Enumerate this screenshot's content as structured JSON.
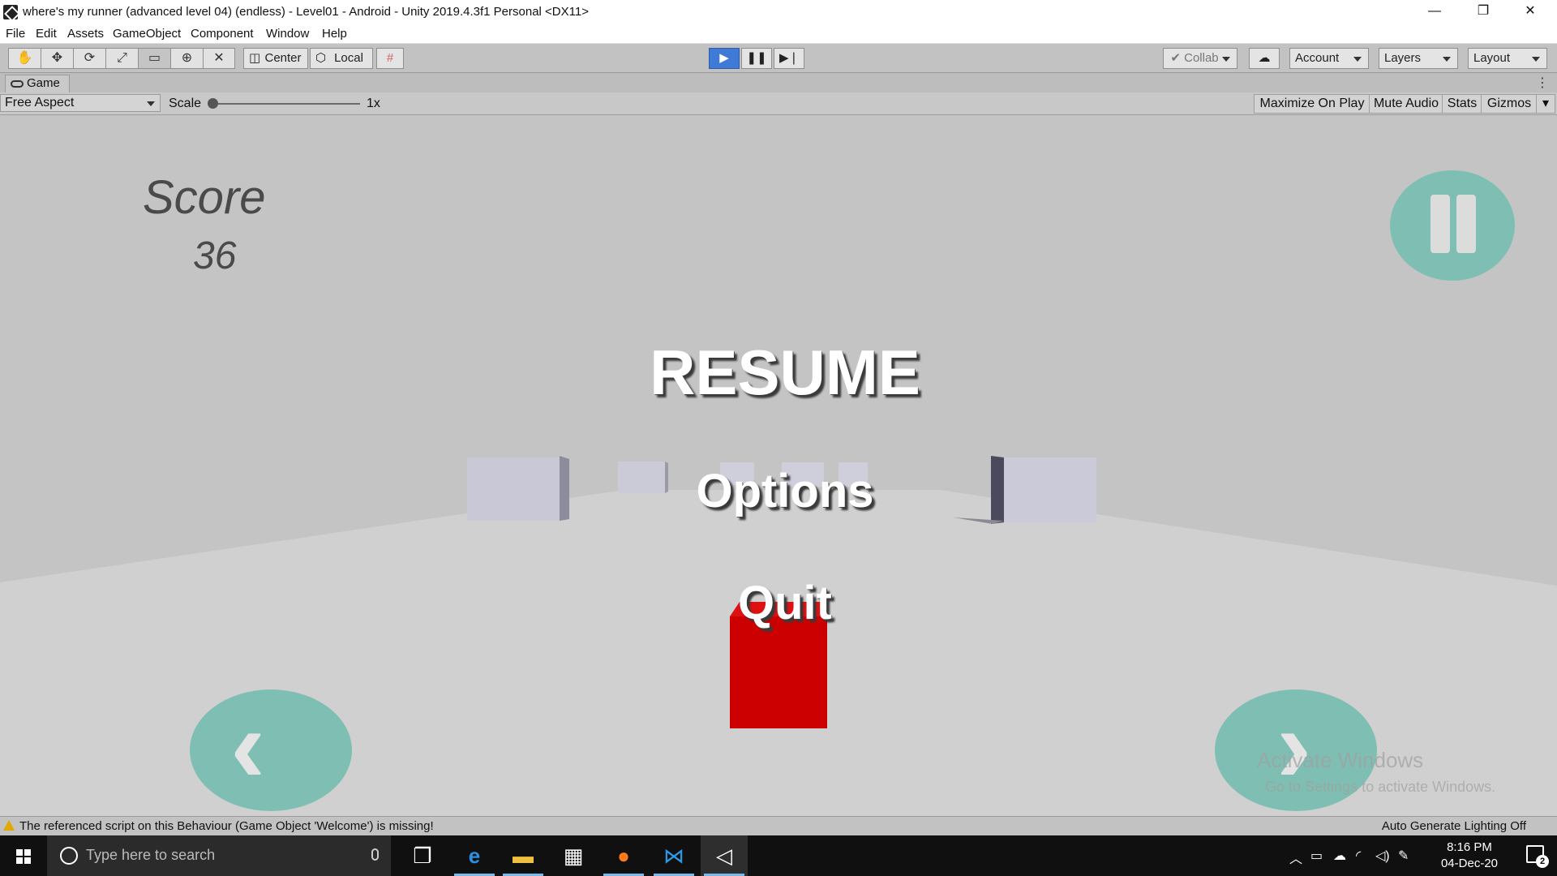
{
  "window": {
    "title": "where's my runner (advanced level 04) (endless) - Level01 - Android - Unity 2019.4.3f1 Personal <DX11>",
    "minimize": "—",
    "restore": "❐",
    "close": "✕"
  },
  "menu": [
    "File",
    "Edit",
    "Assets",
    "GameObject",
    "Component",
    "Window",
    "Help"
  ],
  "toolbar": {
    "tools": [
      "hand-icon",
      "move-icon",
      "rotate-icon",
      "scale-icon",
      "rect-icon",
      "transform-icon",
      "custom-tool-icon"
    ],
    "pivot_label": "Center",
    "space_label": "Local",
    "collab_label": "Collab",
    "account_label": "Account",
    "layers_label": "Layers",
    "layout_label": "Layout"
  },
  "game_tab": {
    "label": "Game"
  },
  "game_bar": {
    "aspect": "Free Aspect",
    "scale_label": "Scale",
    "scale_value": "1x",
    "maximize_on_play": "Maximize On Play",
    "mute_audio": "Mute Audio",
    "stats": "Stats",
    "gizmos": "Gizmos"
  },
  "game": {
    "score_label": "Score",
    "score_value": "36",
    "resume": "RESUME",
    "options": "Options",
    "quit": "Quit",
    "watermark_title": "Activate Windows",
    "watermark_sub": "Go to Settings to activate Windows.",
    "button_color": "#7fbfb3",
    "player_color": "#cc0000"
  },
  "status": {
    "message": "The referenced script on this Behaviour (Game Object 'Welcome') is missing!",
    "right": "Auto Generate Lighting Off"
  },
  "taskbar": {
    "search_placeholder": "Type here to search",
    "time": "8:16 PM",
    "date": "04-Dec-20",
    "notifications": "2"
  }
}
